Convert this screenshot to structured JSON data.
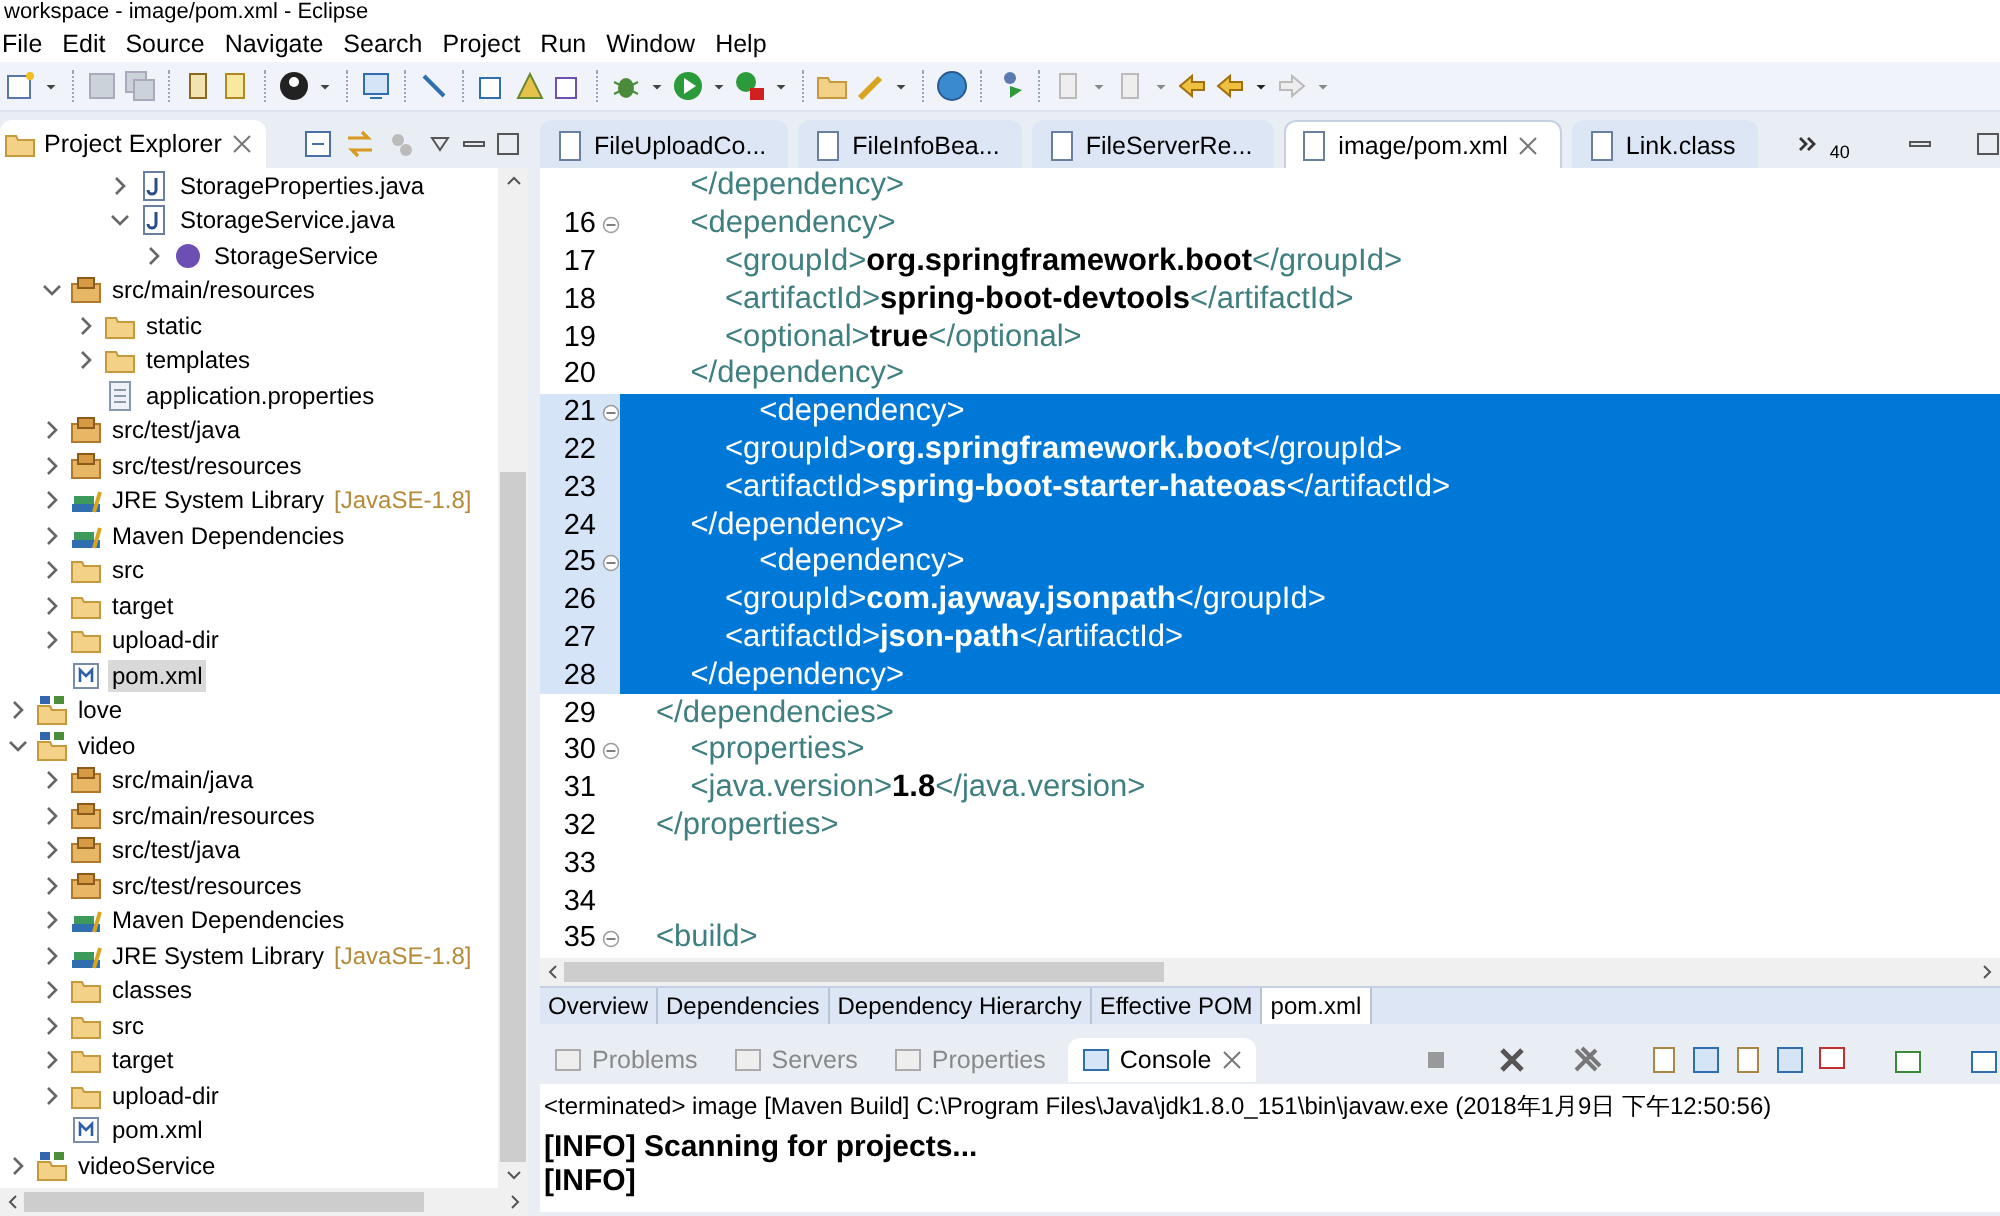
{
  "window": {
    "title": "workspace - image/pom.xml - Eclipse"
  },
  "menu": [
    "File",
    "Edit",
    "Source",
    "Navigate",
    "Search",
    "Project",
    "Run",
    "Window",
    "Help"
  ],
  "explorer": {
    "title": "Project Explorer",
    "tree": [
      {
        "children": [
          {
            "children": [
              {
                "children": [
                  {
                    "label": "StorageProperties.java",
                    "kind": "java",
                    "expanded": false,
                    "selected": false
                  },
                  {
                    "label": "StorageService.java",
                    "kind": "java",
                    "expanded": true,
                    "selected": false,
                    "children": [
                      {
                        "label": "StorageService",
                        "kind": "interface",
                        "expanded": false,
                        "selected": false
                      }
                    ]
                  }
                ]
              }
            ]
          },
          {
            "label": "src/main/resources",
            "kind": "package",
            "expanded": true,
            "selected": false,
            "children": [
              {
                "label": "static",
                "kind": "folder",
                "expanded": false,
                "selected": false
              },
              {
                "label": "templates",
                "kind": "folder",
                "expanded": false,
                "selected": false
              },
              {
                "label": "application.properties",
                "kind": "file",
                "selected": false
              }
            ]
          },
          {
            "label": "src/test/java",
            "kind": "package",
            "expanded": false,
            "selected": false
          },
          {
            "label": "src/test/resources",
            "kind": "package",
            "expanded": false,
            "selected": false
          },
          {
            "label": "JRE System Library",
            "note": "[JavaSE-1.8]",
            "kind": "library",
            "expanded": false,
            "selected": false
          },
          {
            "label": "Maven Dependencies",
            "kind": "library",
            "expanded": false,
            "selected": false
          },
          {
            "label": "src",
            "kind": "folder",
            "expanded": false,
            "selected": false
          },
          {
            "label": "target",
            "kind": "folder",
            "expanded": false,
            "selected": false
          },
          {
            "label": "upload-dir",
            "kind": "folder",
            "expanded": false,
            "selected": false
          },
          {
            "label": "pom.xml",
            "kind": "xml",
            "selected": true
          }
        ]
      },
      {
        "label": "love",
        "kind": "project",
        "expanded": false,
        "selected": false
      },
      {
        "label": "video",
        "kind": "project",
        "expanded": true,
        "selected": false,
        "children": [
          {
            "label": "src/main/java",
            "kind": "package",
            "expanded": false,
            "selected": false
          },
          {
            "label": "src/main/resources",
            "kind": "package",
            "expanded": false,
            "selected": false
          },
          {
            "label": "src/test/java",
            "kind": "package",
            "expanded": false,
            "selected": false
          },
          {
            "label": "src/test/resources",
            "kind": "package",
            "expanded": false,
            "selected": false
          },
          {
            "label": "Maven Dependencies",
            "kind": "library",
            "expanded": false,
            "selected": false
          },
          {
            "label": "JRE System Library",
            "note": "[JavaSE-1.8]",
            "kind": "library",
            "expanded": false,
            "selected": false
          },
          {
            "label": "classes",
            "kind": "folder",
            "expanded": false,
            "selected": false
          },
          {
            "label": "src",
            "kind": "folder",
            "expanded": false,
            "selected": false
          },
          {
            "label": "target",
            "kind": "folder",
            "expanded": false,
            "selected": false
          },
          {
            "label": "upload-dir",
            "kind": "folder",
            "expanded": false,
            "selected": false
          },
          {
            "label": "pom.xml",
            "kind": "xml",
            "selected": false
          }
        ]
      },
      {
        "label": "videoService",
        "kind": "project",
        "expanded": false,
        "selected": false
      }
    ]
  },
  "editor_tabs": [
    {
      "label": "FileUploadCo...",
      "selected": false
    },
    {
      "label": "FileInfoBea...",
      "selected": false
    },
    {
      "label": "FileServerRe...",
      "selected": false
    },
    {
      "label": "image/pom.xml",
      "selected": true
    },
    {
      "label": "Link.class",
      "selected": false
    }
  ],
  "hidden_tab_count": "40",
  "code": [
    {
      "text": "    </dependency>",
      "selected": false
    },
    {
      "number": "16",
      "text": "    <dependency>",
      "selected": false,
      "fold": true
    },
    {
      "number": "17",
      "text": "        <groupId>**org.springframework.boot**</groupId>",
      "selected": false
    },
    {
      "number": "18",
      "text": "        <artifactId>**spring-boot-devtools**</artifactId>",
      "selected": false
    },
    {
      "number": "19",
      "text": "        <optional>**true**</optional>",
      "selected": false
    },
    {
      "number": "20",
      "text": "    </dependency>",
      "selected": false
    },
    {
      "number": "21",
      "text": "            <dependency>",
      "selected": true,
      "fold": true
    },
    {
      "number": "22",
      "text": "        <groupId>**org.springframework.boot**</groupId>",
      "selected": true
    },
    {
      "number": "23",
      "text": "        <artifactId>**spring-boot-starter-hateoas**</artifactId>",
      "selected": true
    },
    {
      "number": "24",
      "text": "    </dependency>",
      "selected": true
    },
    {
      "number": "25",
      "text": "            <dependency>",
      "selected": true,
      "fold": true
    },
    {
      "number": "26",
      "text": "        <groupId>**com.jayway.jsonpath**</groupId>",
      "selected": true
    },
    {
      "number": "27",
      "text": "        <artifactId>**json-path**</artifactId>",
      "selected": true
    },
    {
      "number": "28",
      "text": "    </dependency>",
      "selected": true
    },
    {
      "number": "29",
      "text": "</dependencies>",
      "selected": false
    },
    {
      "number": "30",
      "text": "    <properties>",
      "selected": false,
      "fold": true
    },
    {
      "number": "31",
      "text": "    <java.version>**1.8**</java.version>",
      "selected": false
    },
    {
      "number": "32",
      "text": "</properties>",
      "selected": false
    },
    {
      "number": "33",
      "selected": false
    },
    {
      "number": "34",
      "selected": false
    },
    {
      "number": "35",
      "text": "<build>",
      "selected": false,
      "fold": true
    }
  ],
  "pom_tabs": [
    {
      "label": "Overview",
      "selected": false
    },
    {
      "label": "Dependencies",
      "selected": false
    },
    {
      "label": "Dependency Hierarchy",
      "selected": false
    },
    {
      "label": "Effective POM",
      "selected": false
    },
    {
      "label": "pom.xml",
      "selected": true
    }
  ],
  "console_tabs": [
    {
      "label": "Problems",
      "selected": false
    },
    {
      "label": "Servers",
      "selected": false
    },
    {
      "label": "Properties",
      "selected": false
    },
    {
      "label": "Console",
      "selected": true
    }
  ],
  "console": {
    "header": "<terminated> image [Maven Build] C:\\Program Files\\Java\\jdk1.8.0_151\\bin\\javaw.exe (2018年1月9日 下午12:50:56)",
    "lines": [
      "[INFO] Scanning for projects...",
      "[INFO]"
    ]
  }
}
